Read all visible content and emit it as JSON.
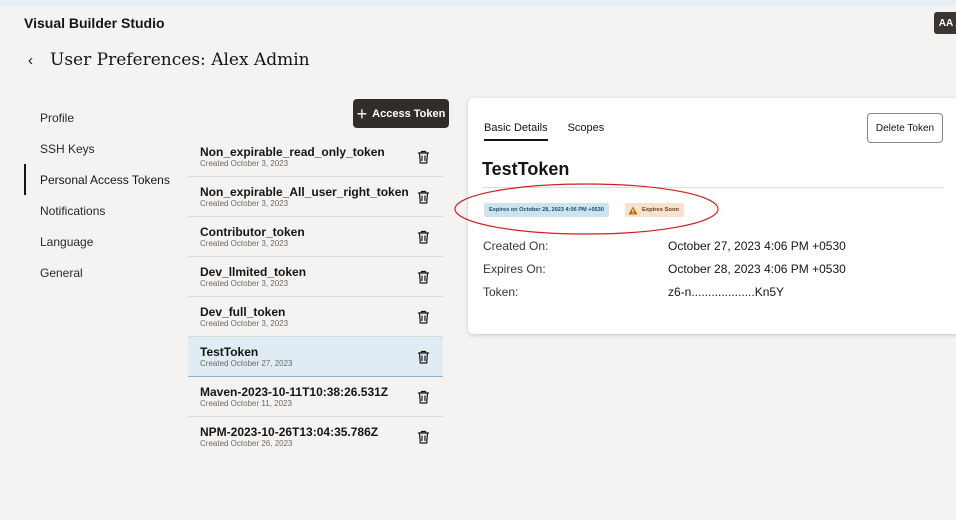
{
  "app": {
    "title": "Visual Builder Studio",
    "avatar": "AA"
  },
  "page": {
    "back_icon": "chevron-left-icon",
    "title": "User Preferences: Alex Admin"
  },
  "sidenav": {
    "items": [
      {
        "label": "Profile"
      },
      {
        "label": "SSH Keys"
      },
      {
        "label": "Personal Access Tokens",
        "active": true
      },
      {
        "label": "Notifications"
      },
      {
        "label": "Language"
      },
      {
        "label": "General"
      }
    ]
  },
  "add_button": {
    "icon": "plus-icon",
    "label": "Access Token"
  },
  "tokens": [
    {
      "name": "Non_expirable_read_only_token",
      "created": "Created October 3, 2023"
    },
    {
      "name": "Non_expirable_All_user_right_token",
      "created": "Created October 3, 2023"
    },
    {
      "name": "Contributor_token",
      "created": "Created October 3, 2023"
    },
    {
      "name": "Dev_llmited_token",
      "created": "Created October 3, 2023"
    },
    {
      "name": "Dev_full_token",
      "created": "Created October 3, 2023"
    },
    {
      "name": "TestToken",
      "created": "Created October 27, 2023",
      "selected": true
    },
    {
      "name": "Maven-2023-10-11T10:38:26.531Z",
      "created": "Created October 11, 2023"
    },
    {
      "name": "NPM-2023-10-26T13:04:35.786Z",
      "created": "Created October 26, 2023"
    }
  ],
  "detail": {
    "tabs": [
      {
        "label": "Basic Details",
        "active": true
      },
      {
        "label": "Scopes"
      }
    ],
    "delete_label": "Delete Token",
    "token_title": "TestToken",
    "expires_badge": "Expires on October 28, 2023 4:06 PM +0530",
    "soon_badge": "Expires Soon",
    "fields": [
      {
        "label": "Created On:",
        "value": "October 27, 2023 4:06 PM +0530"
      },
      {
        "label": "Expires On:",
        "value": "October 28, 2023 4:06 PM +0530"
      },
      {
        "label": "Token:",
        "value": "z6-n...................Kn5Y"
      }
    ]
  },
  "colors": {
    "primary_button": "#312d2a",
    "selected_row": "#dfecf3",
    "annotation": "#d31f1f",
    "warning": "#c26a00"
  }
}
